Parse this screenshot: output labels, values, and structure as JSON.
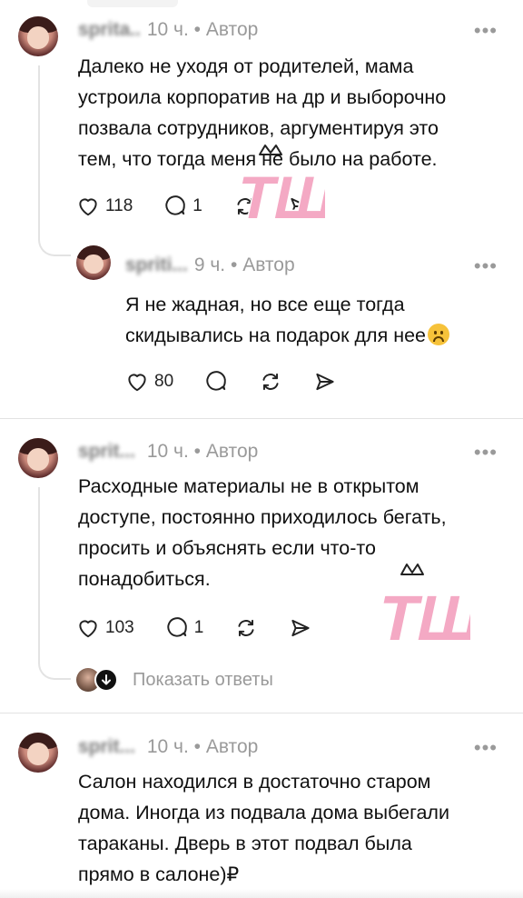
{
  "comments": [
    {
      "id": "c1",
      "username": "sprita...",
      "time": "10 ч.",
      "separator": "•",
      "badge": "Автор",
      "more": "•••",
      "text_lines": [
        "Далеко не уходя от родителей, мама",
        "устроила корпоратив на др и выборочно",
        "позвала сотрудников, аргументируя это",
        "тем, что тогда меня не было на работе."
      ],
      "likes": "118",
      "replies": "1"
    },
    {
      "id": "c1-reply",
      "username": "spriti...",
      "time": "9 ч.",
      "separator": "•",
      "badge": "Автор",
      "more": "•••",
      "text_lines": [
        "Я не жадная, но все еще тогда",
        "скидывались на подарок для нее"
      ],
      "likes": "80",
      "replies": ""
    },
    {
      "id": "c2",
      "username": "sprit...",
      "time": "10 ч.",
      "separator": "•",
      "badge": "Автор",
      "more": "•••",
      "text_lines": [
        "Расходные материалы не в открытом",
        "доступе, постоянно приходилось бегать,",
        "просить и объяснять если что-то",
        "понадобиться."
      ],
      "likes": "103",
      "replies": "1",
      "show_replies_label": "Показать ответы"
    },
    {
      "id": "c3",
      "username": "sprit...",
      "time": "10 ч.",
      "separator": "•",
      "badge": "Автор",
      "more": "•••",
      "text_lines": [
        "Салон находился в достаточно старом",
        "дома. Иногда из подвала дома выбегали",
        "тараканы. Дверь в этот подвал была",
        "прямо в салоне)₽"
      ]
    }
  ],
  "icons": {
    "like": "heart-icon",
    "reply": "comment-bubble-icon",
    "repost": "repost-icon",
    "share": "send-icon",
    "emoji": "sad-face-emoji"
  },
  "watermark": {
    "text": "ТШ",
    "color": "#f4a9c4"
  },
  "colors": {
    "meta": "#9a9a9a",
    "text": "#101010",
    "divider": "#e2e2e2"
  }
}
